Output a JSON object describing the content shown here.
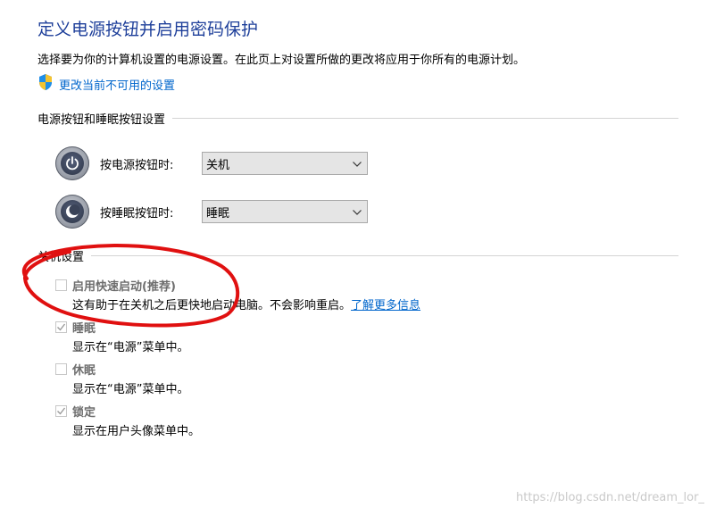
{
  "page": {
    "title": "定义电源按钮并启用密码保护",
    "description": "选择要为你的计算机设置的电源设置。在此页上对设置所做的更改将应用于你所有的电源计划。",
    "change_link": "更改当前不可用的设置"
  },
  "power_buttons": {
    "section_label": "电源按钮和睡眠按钮设置",
    "power_row": {
      "label": "按电源按钮时:",
      "value": "关机",
      "icon": "power-icon"
    },
    "sleep_row": {
      "label": "按睡眠按钮时:",
      "value": "睡眠",
      "icon": "sleep-moon-icon"
    }
  },
  "shutdown": {
    "section_label": "关机设置",
    "options": [
      {
        "label": "启用快速启动(推荐)",
        "checked": false,
        "description": "这有助于在关机之后更快地启动电脑。不会影响重启。",
        "link": "了解更多信息"
      },
      {
        "label": "睡眠",
        "checked": true,
        "description": "显示在“电源”菜单中。"
      },
      {
        "label": "休眠",
        "checked": false,
        "description": "显示在“电源”菜单中。"
      },
      {
        "label": "锁定",
        "checked": true,
        "description": "显示在用户头像菜单中。"
      }
    ]
  },
  "colors": {
    "title": "#1e3f9a",
    "link": "#0066cc",
    "annotation_red": "#e01010",
    "disabled_text": "#6d6d6d"
  },
  "watermark": "https://blog.csdn.net/dream_lor_"
}
